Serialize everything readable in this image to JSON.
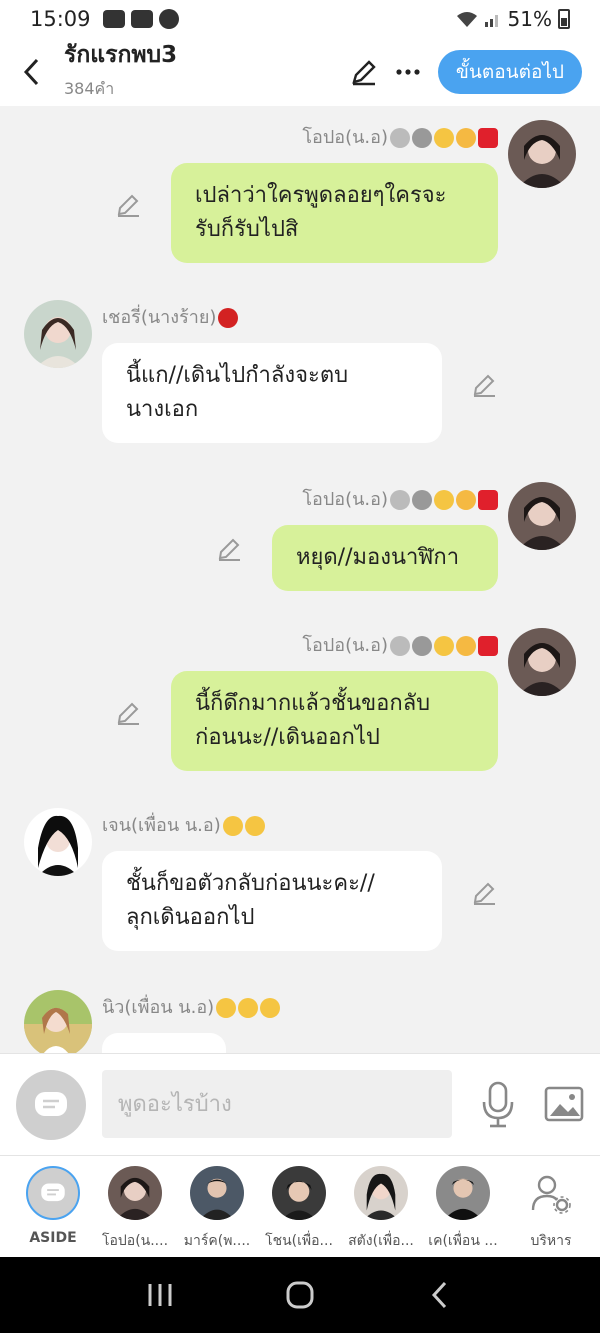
{
  "status_bar": {
    "time": "15:09",
    "battery": "51%"
  },
  "header": {
    "title": "รักแรกพบ3",
    "word_count": "384คำ",
    "next_label": "ขั้นตอนต่อไป"
  },
  "messages": [
    {
      "side": "right",
      "name": "โอปอ(น.อ)",
      "text_1": "เปล่าว่าใครพูดลอยๆใครจะ",
      "text_2": "รับก็รับไปสิ"
    },
    {
      "side": "left",
      "name": "เชอรี่(นางร้าย)",
      "text_1": "นี้แก//เดินไปกำลังจะตบ",
      "text_2": "นางเอก"
    },
    {
      "side": "right",
      "name": "โอปอ(น.อ)",
      "text_1": "หยุด//มองนาฬิกา"
    },
    {
      "side": "right",
      "name": "โอปอ(น.อ)",
      "text_1": "นี้ก็ดึกมากแล้วชั้นขอกลับ",
      "text_2": "ก่อนนะ//เดินออกไป"
    },
    {
      "side": "left",
      "name": "เจน(เพื่อน น.อ)",
      "text_1": "ชั้นก็ขอตัวกลับก่อนนะคะ//",
      "text_2": "ลุกเดินออกไป"
    },
    {
      "side": "left",
      "name": "นิว(เพื่อน น.อ)"
    }
  ],
  "input": {
    "placeholder": "พูดอะไรบ้าง"
  },
  "characters": [
    {
      "label": "ASIDE"
    },
    {
      "label": "โอปอ(น...."
    },
    {
      "label": "มาร์ค(พ...."
    },
    {
      "label": "โชน(เพื่อ..."
    },
    {
      "label": "สตัง(เพื่อ..."
    },
    {
      "label": "เค(เพื่อน ..."
    },
    {
      "label": "บริหาร"
    }
  ],
  "colors": {
    "accent": "#4aa3f0",
    "right_bubble": "#d7f19a",
    "left_bubble": "#ffffff",
    "background": "#f2f2f2"
  },
  "icons": [
    "back-arrow-icon",
    "pencil-icon",
    "more-icon",
    "edit-icon",
    "chat-icon",
    "mic-icon",
    "image-icon",
    "person-gear-icon",
    "recents-icon",
    "home-icon",
    "nav-back-icon"
  ]
}
